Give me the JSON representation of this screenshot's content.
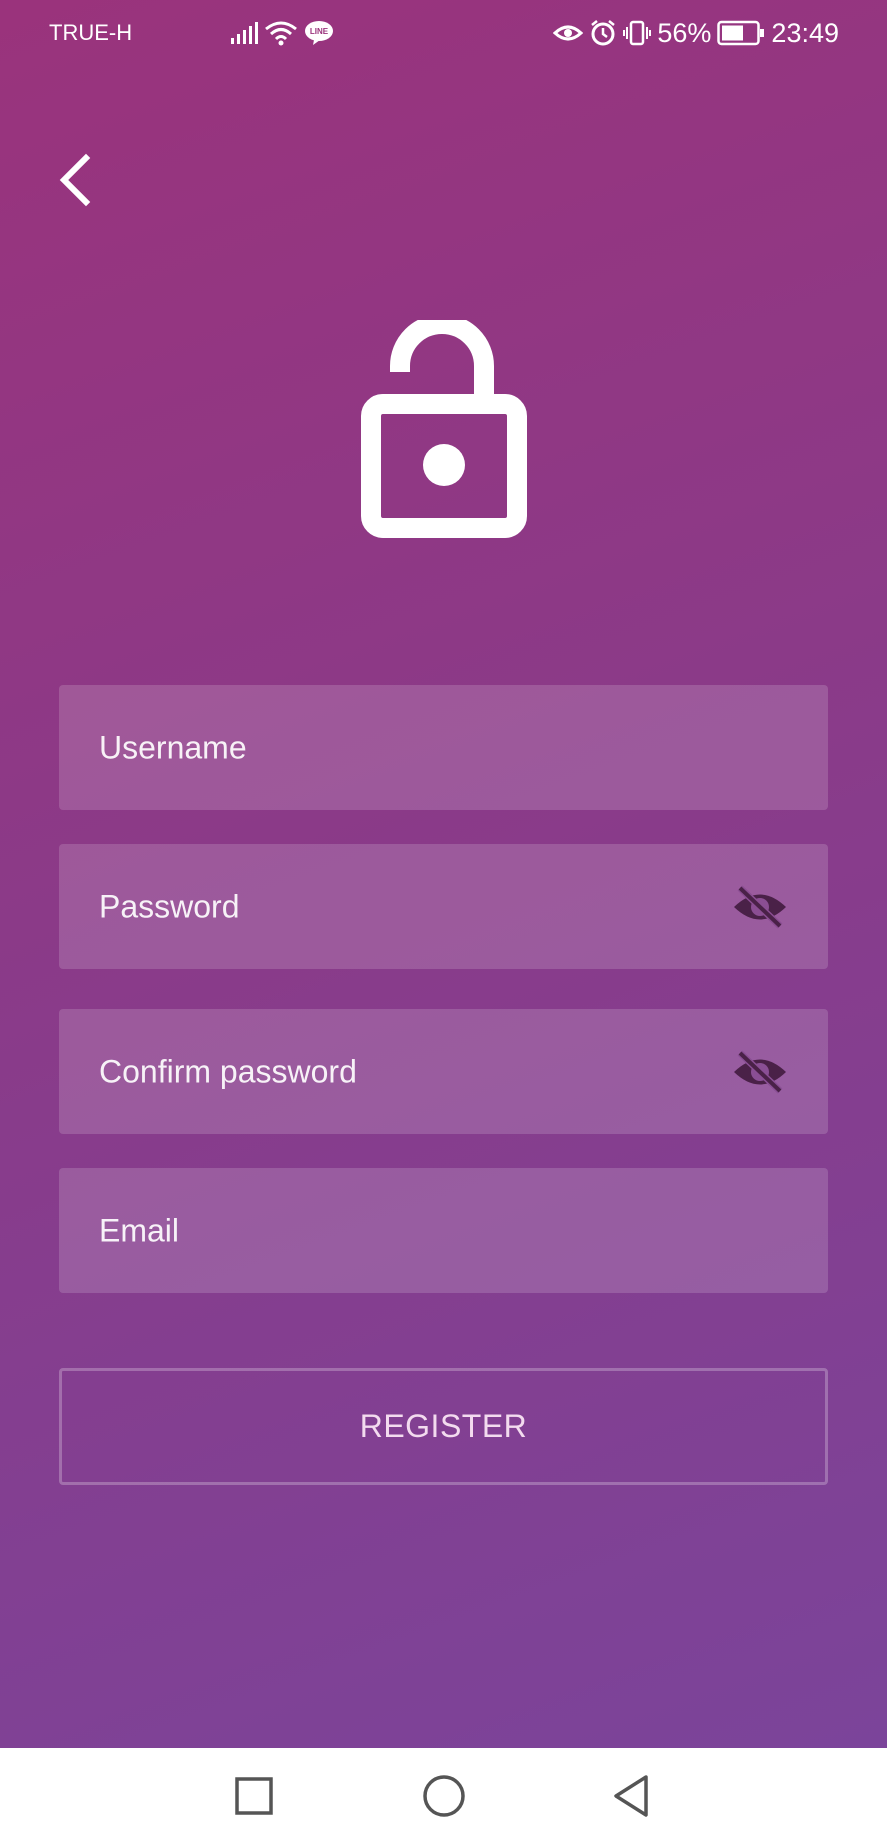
{
  "status_bar": {
    "carrier": "TRUE-H",
    "battery_percent": "56%",
    "time": "23:49",
    "left_icons": [
      "signal-icon",
      "wifi-icon",
      "line-app-icon"
    ],
    "right_icons": [
      "eye-comfort-icon",
      "alarm-icon",
      "vibrate-icon",
      "battery-icon"
    ],
    "line_badge": "LINE"
  },
  "header": {
    "back_icon": "chevron-left-icon"
  },
  "hero": {
    "icon": "unlocked-padlock-icon"
  },
  "form": {
    "username_placeholder": "Username",
    "password_placeholder": "Password",
    "confirm_password_placeholder": "Confirm password",
    "email_placeholder": "Email",
    "visibility_icon": "eye-off-icon"
  },
  "register_label": "REGISTER",
  "colors": {
    "gradient_top": "#9a337c",
    "gradient_bottom": "#7b449a",
    "field_bg": "rgba(255,255,255,0.16)",
    "register_text": "#f3dbef",
    "eye_icon": "#4a2148"
  },
  "nav_bar": {
    "icons": [
      "recents-square-icon",
      "home-circle-icon",
      "back-triangle-icon"
    ]
  }
}
